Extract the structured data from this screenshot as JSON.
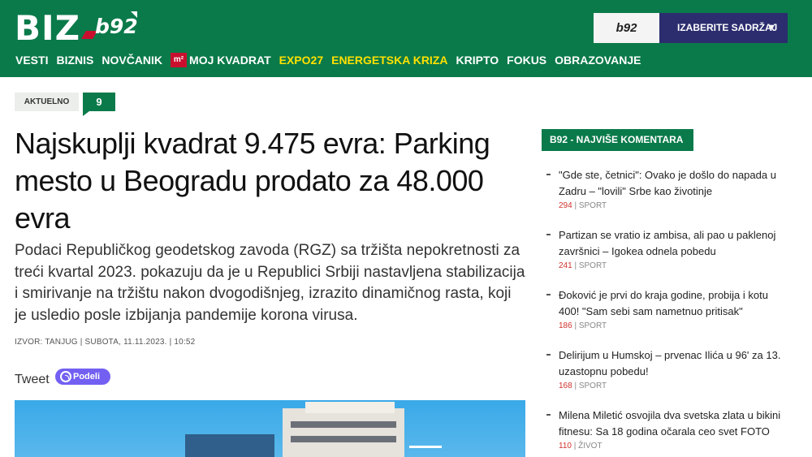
{
  "header": {
    "logo_biz": "BIZ",
    "logo_b92": "b92",
    "b92_button": "b92",
    "select_label": "IZABERITE SADRŽAJ",
    "brand_color": "#0a7a4a"
  },
  "nav": {
    "items": [
      {
        "label": "VESTI"
      },
      {
        "label": "BIZNIS"
      },
      {
        "label": "NOVČANIK"
      },
      {
        "label": "MOJ KVADRAT",
        "badge": "m²"
      },
      {
        "label": "EXPO27",
        "highlight": "#ffe000"
      },
      {
        "label": "ENERGETSKA KRIZA",
        "highlight": "#ffe000"
      },
      {
        "label": "KRIPTO"
      },
      {
        "label": "FOKUS"
      },
      {
        "label": "OBRAZOVANJE"
      }
    ]
  },
  "article": {
    "tag": "AKTUELNO",
    "comment_count": "9",
    "title": "Najskuplji kvadrat 9.475 evra: Parking mesto u Beogradu prodato za 48.000 evra",
    "lead": "Podaci Republičkog geodetskog zavoda (RGZ) sa tržišta nepokretnosti za treći kvartal 2023. pokazuju da je u Republici Srbiji nastavljena stabilizacija i smirivanje na tržištu nakon dvogodišnjeg, izrazito dinamičnog rasta, koji je usledio posle izbijanja pandemije korona virusa.",
    "meta": "IZVOR: TANJUG | SUBOTA, 11.11.2023. | 10:52",
    "tweet_label": "Tweet",
    "share_label": "Podeli"
  },
  "sidebar": {
    "heading": "B92 - NAJVIŠE KOMENTARA",
    "items": [
      {
        "text": "\"Gde ste, četnici\": Ovako je došlo do napada u Zadru – \"lovili\" Srbe kao životinje",
        "count": "294",
        "category": "SPORT"
      },
      {
        "text": "Partizan se vratio iz ambisa, ali pao u paklenoj završnici – Igokea odnela pobedu",
        "count": "241",
        "category": "SPORT"
      },
      {
        "text": "Đoković je prvi do kraja godine, probija i kotu 400! \"Sam sebi sam nametnuo pritisak\"",
        "count": "186",
        "category": "SPORT"
      },
      {
        "text": "Delirijum u Humskoj – prvenac Ilića u 96' za 13. uzastopnu pobedu!",
        "count": "168",
        "category": "SPORT"
      },
      {
        "text": "Milena Miletić osvojila dva svetska zlata u bikini fitnesu: Sa 18 godina očarala ceo svet FOTO",
        "count": "110",
        "category": "ŽIVOT"
      }
    ]
  }
}
